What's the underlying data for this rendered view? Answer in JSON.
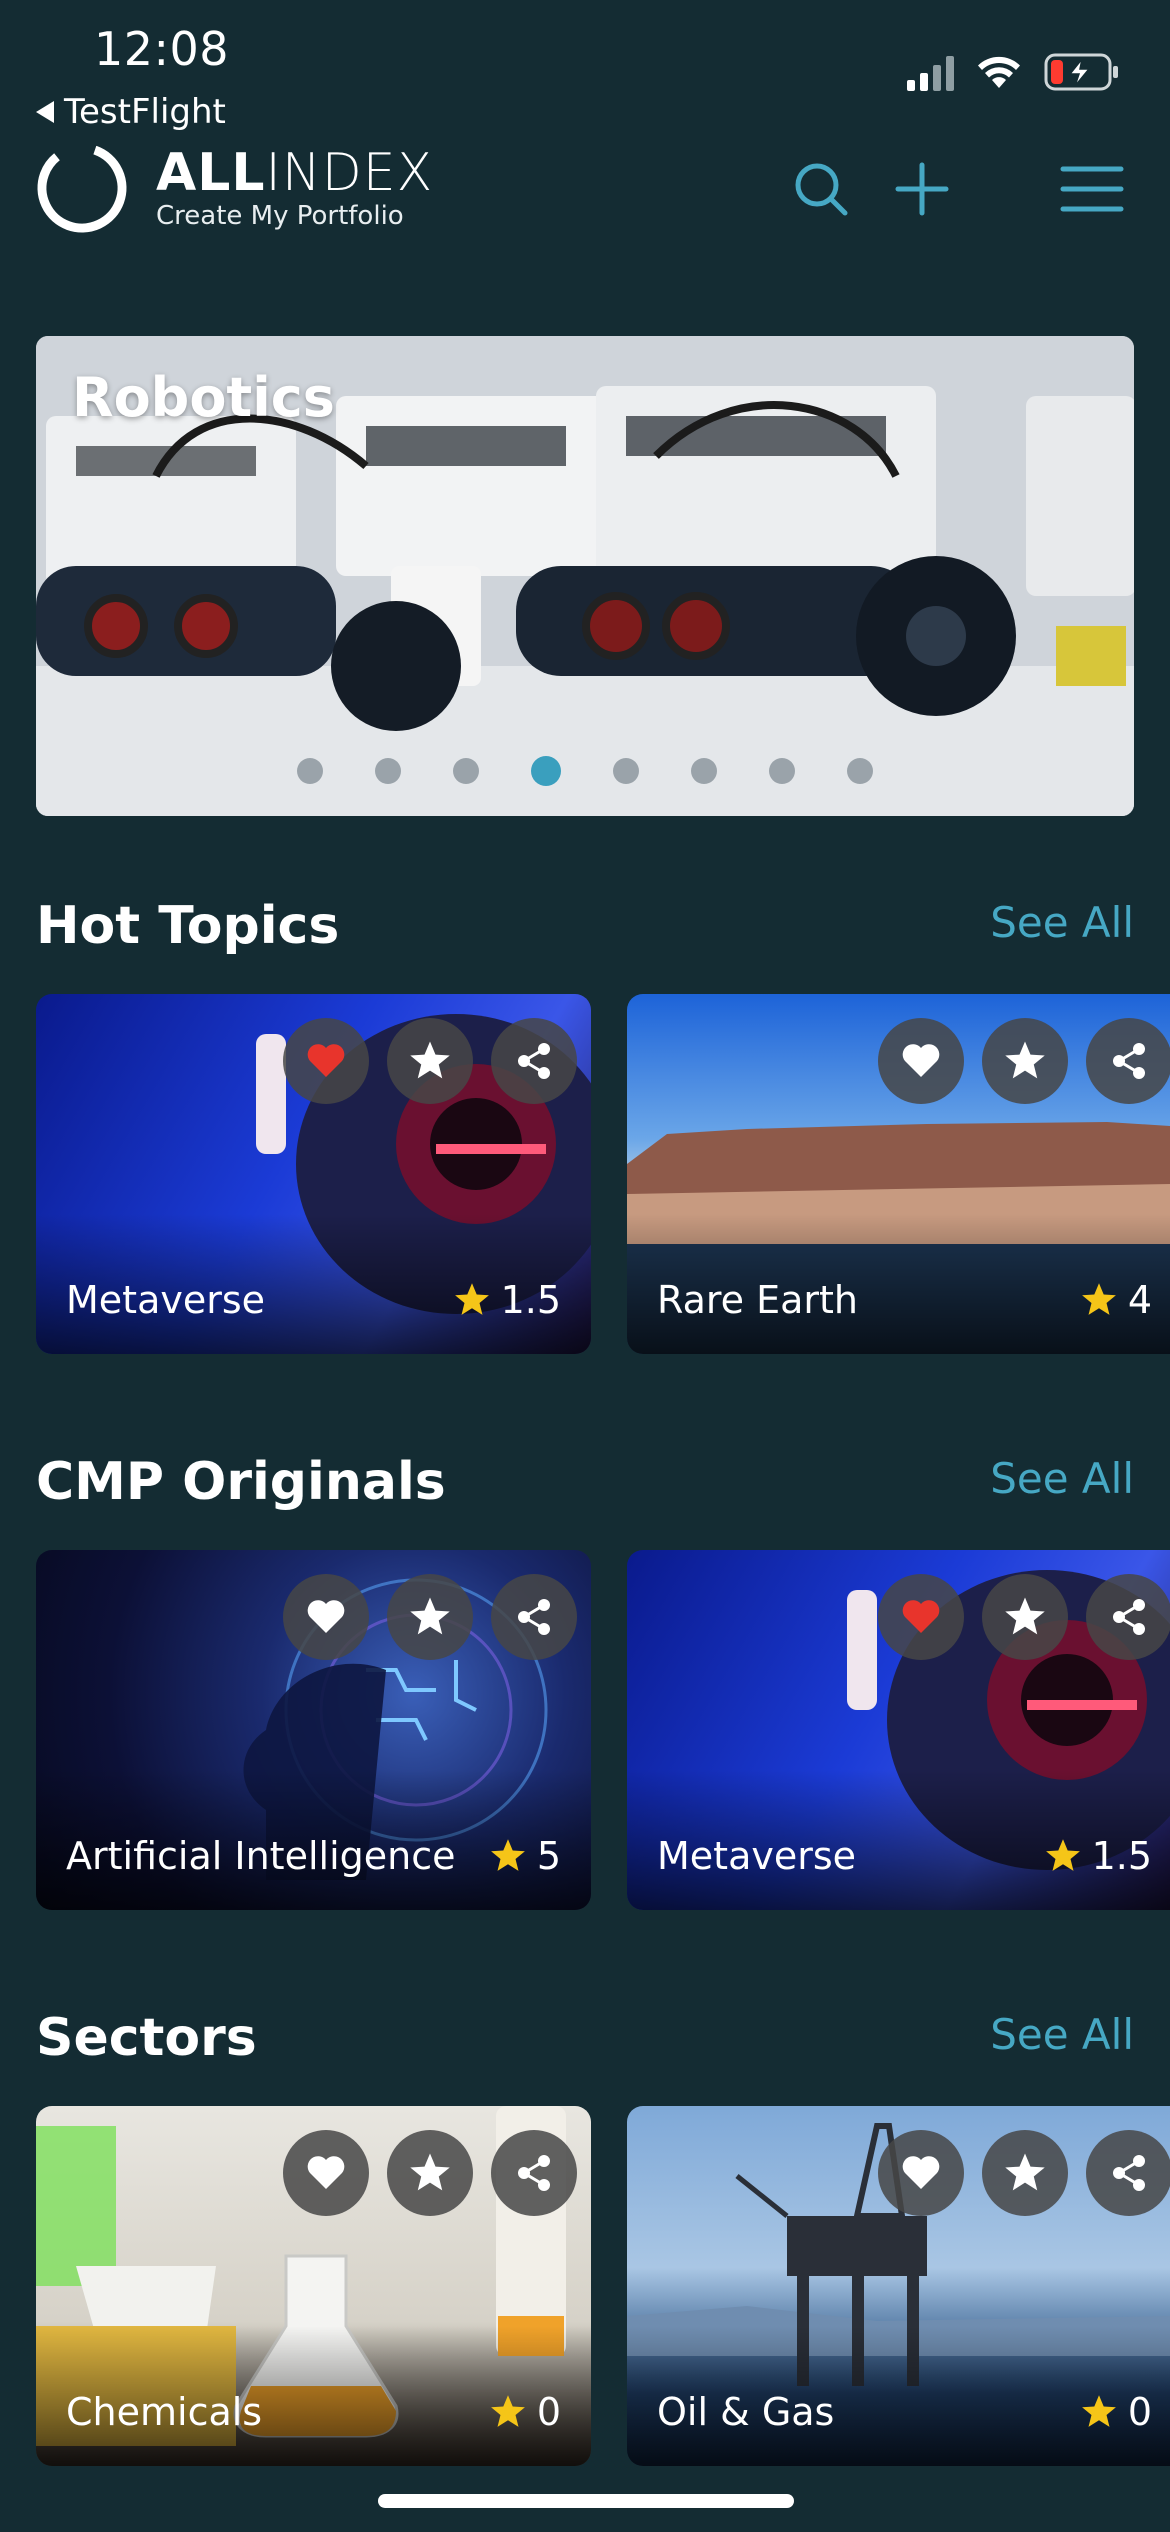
{
  "status_bar": {
    "time": "12:08",
    "back_app": "TestFlight"
  },
  "header": {
    "brand_bold": "ALL",
    "brand_light": "INDEX",
    "tagline": "Create My Portfolio",
    "accent_color": "#46a8c4"
  },
  "hero": {
    "title": "Robotics",
    "slide_count": 8,
    "active_slide_index": 3
  },
  "sections": [
    {
      "title": "Hot Topics",
      "see_all": "See All",
      "cards": [
        {
          "label": "Metaverse",
          "rating": "1.5",
          "liked": true,
          "theme": "vr-headset"
        },
        {
          "label": "Rare Earth",
          "rating": "4",
          "liked": false,
          "theme": "mesa-landscape"
        }
      ]
    },
    {
      "title": "CMP Originals",
      "see_all": "See All",
      "cards": [
        {
          "label": "Artificial Intelligence",
          "rating": "5",
          "liked": false,
          "theme": "ai-brain"
        },
        {
          "label": "Metaverse",
          "rating": "1.5",
          "liked": true,
          "theme": "vr-headset"
        }
      ]
    },
    {
      "title": "Sectors",
      "see_all": "See All",
      "cards": [
        {
          "label": "Chemicals",
          "rating": "0",
          "liked": false,
          "theme": "lab-flasks"
        },
        {
          "label": "Oil & Gas",
          "rating": "0",
          "liked": false,
          "theme": "oil-rig"
        }
      ]
    }
  ],
  "colors": {
    "background": "#142c33",
    "liked_heart": "#e8342c",
    "star": "#f5c518"
  }
}
